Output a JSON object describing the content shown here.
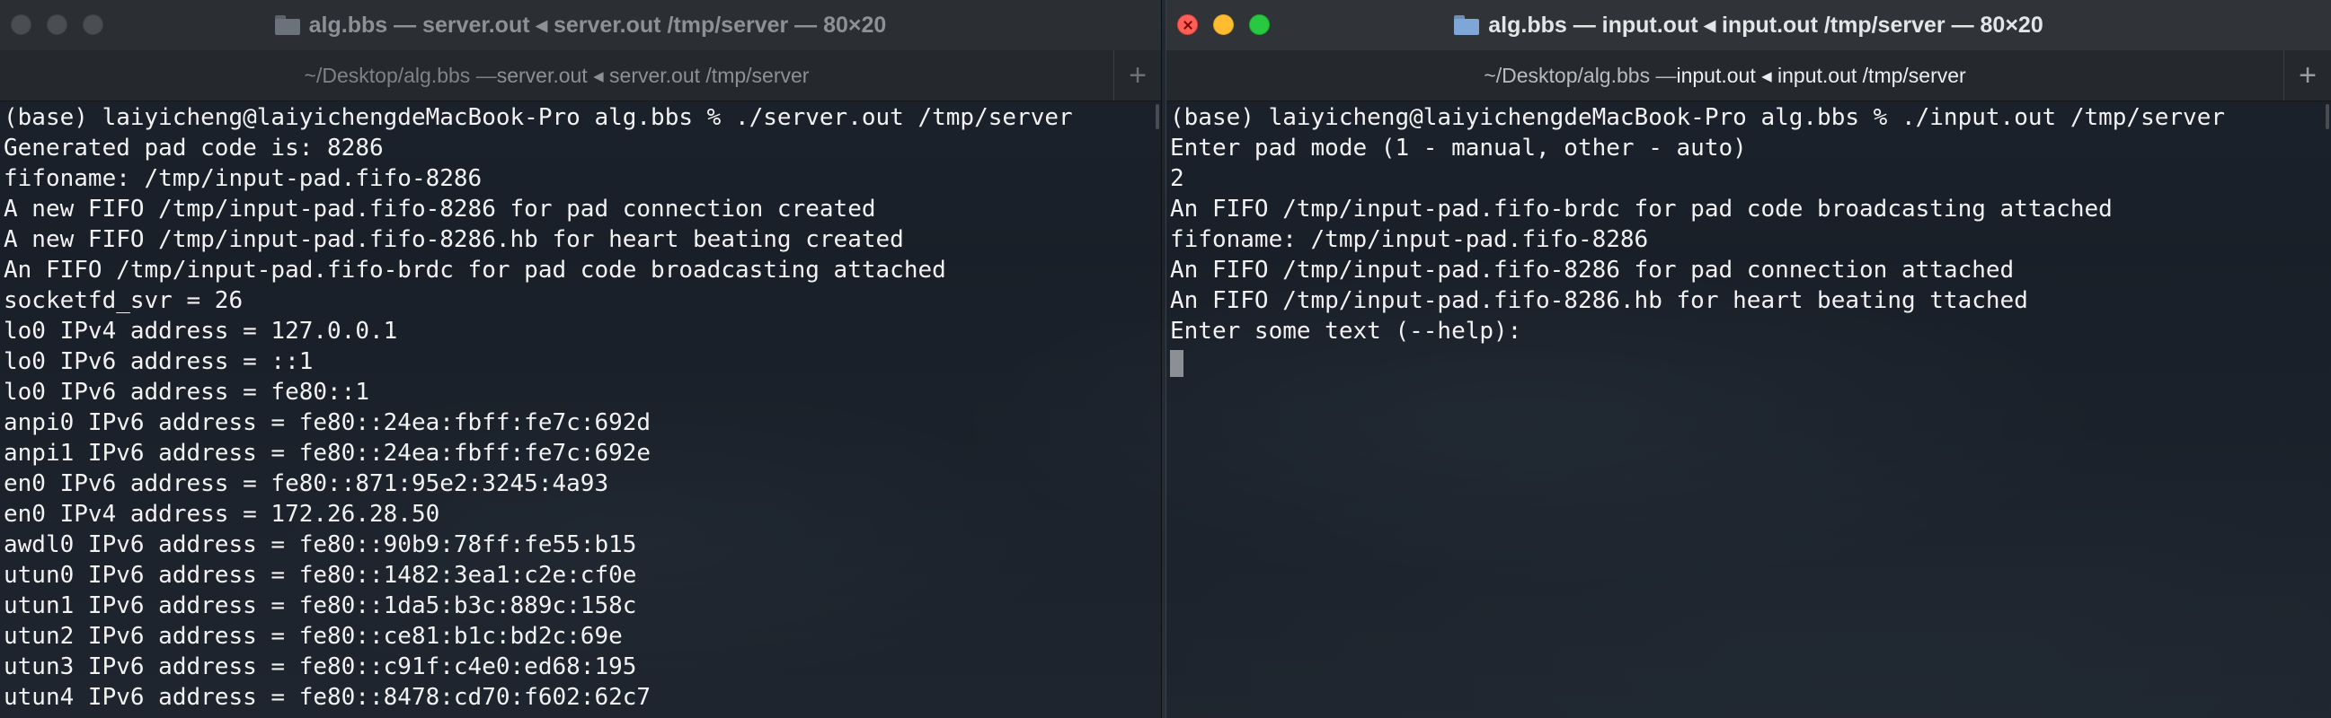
{
  "left_window": {
    "title": "alg.bbs — server.out ◂ server.out /tmp/server — 80×20",
    "tab": {
      "prefix": "~/Desktop/alg.bbs — ",
      "highlight": "server.out ◂ server.out /tmp/server",
      "suffix": ""
    },
    "add_tab": "+",
    "lines": [
      "(base) laiyicheng@laiyichengdeMacBook-Pro alg.bbs % ./server.out /tmp/server",
      "Generated pad code is: 8286",
      "fifoname: /tmp/input-pad.fifo-8286",
      "A new FIFO /tmp/input-pad.fifo-8286 for pad connection created",
      "A new FIFO /tmp/input-pad.fifo-8286.hb for heart beating created",
      "An FIFO /tmp/input-pad.fifo-brdc for pad code broadcasting attached",
      "socketfd_svr = 26",
      "lo0 IPv4 address = 127.0.0.1",
      "lo0 IPv6 address = ::1",
      "lo0 IPv6 address = fe80::1",
      "anpi0 IPv6 address = fe80::24ea:fbff:fe7c:692d",
      "anpi1 IPv6 address = fe80::24ea:fbff:fe7c:692e",
      "en0 IPv6 address = fe80::871:95e2:3245:4a93",
      "en0 IPv4 address = 172.26.28.50",
      "awdl0 IPv6 address = fe80::90b9:78ff:fe55:b15",
      "utun0 IPv6 address = fe80::1482:3ea1:c2e:cf0e",
      "utun1 IPv6 address = fe80::1da5:b3c:889c:158c",
      "utun2 IPv6 address = fe80::ce81:b1c:bd2c:69e",
      "utun3 IPv6 address = fe80::c91f:c4e0:ed68:195",
      "utun4 IPv6 address = fe80::8478:cd70:f602:62c7"
    ]
  },
  "right_window": {
    "title": "alg.bbs — input.out ◂ input.out /tmp/server — 80×20",
    "tab": {
      "prefix": "~/Desktop/alg.bbs — ",
      "highlight": "input.out ◂ input.out /tmp/server",
      "suffix": ""
    },
    "add_tab": "+",
    "lines": [
      "(base) laiyicheng@laiyichengdeMacBook-Pro alg.bbs % ./input.out /tmp/server",
      "Enter pad mode (1 - manual, other - auto)",
      "2",
      "An FIFO /tmp/input-pad.fifo-brdc for pad code broadcasting attached",
      "fifoname: /tmp/input-pad.fifo-8286",
      "An FIFO /tmp/input-pad.fifo-8286 for pad connection attached",
      "An FIFO /tmp/input-pad.fifo-8286.hb for heart beating ttached",
      "Enter some text (--help):"
    ]
  },
  "icons": {
    "folder": "folder-icon",
    "close": "close-icon",
    "minimize": "minimize-icon",
    "maximize": "maximize-icon",
    "add_tab": "plus-icon"
  },
  "colors": {
    "close": "#ff5f57",
    "minimize": "#febc2e",
    "maximize": "#28c840",
    "terminal_text": "#f2f2f2"
  }
}
